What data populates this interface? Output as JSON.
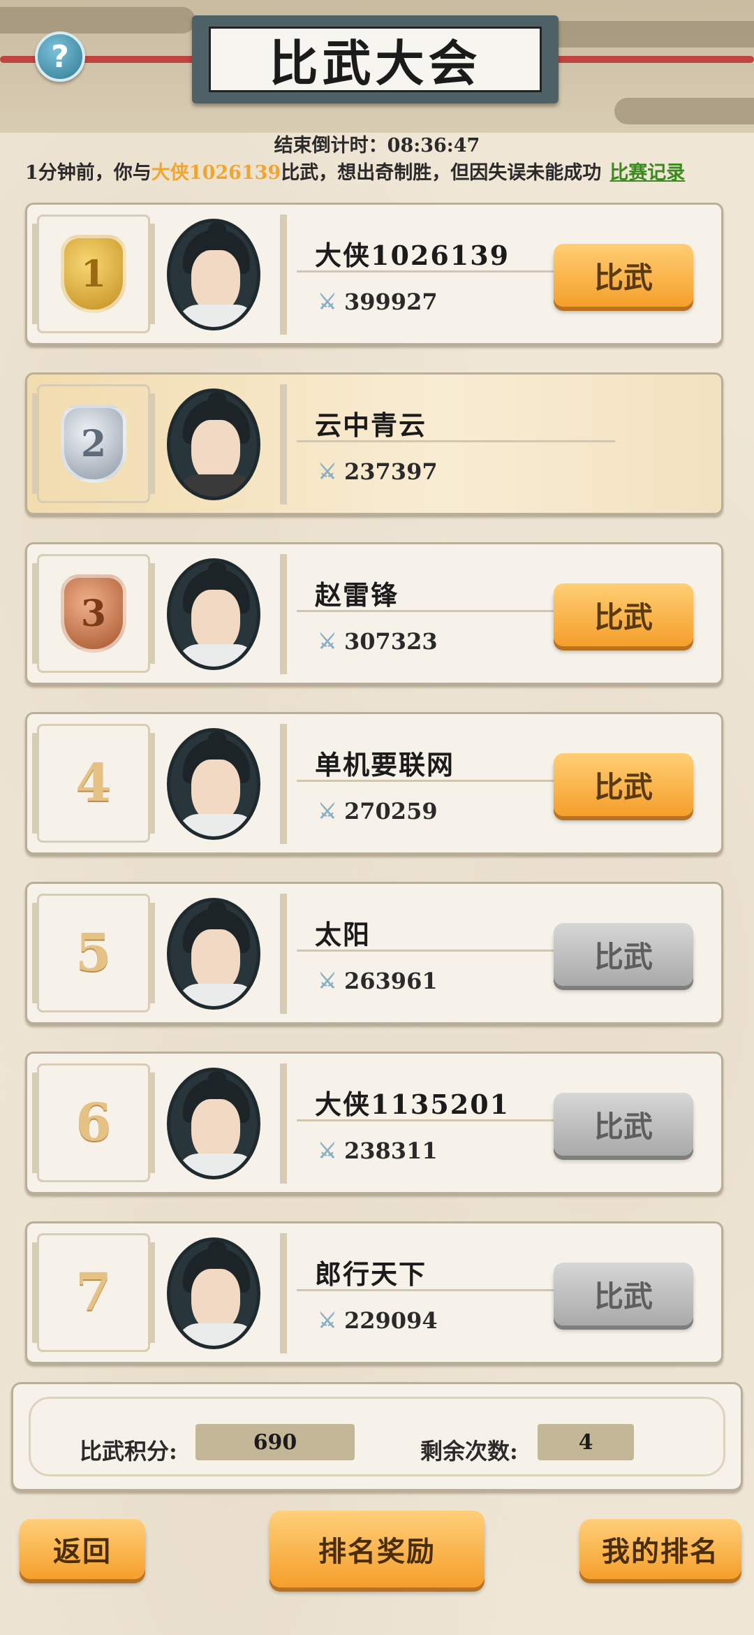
{
  "header": {
    "title": "比武大会",
    "help_icon": "question-mark-icon",
    "help_symbol": "?"
  },
  "countdown": {
    "label": "结束倒计时：",
    "time": "08:36:47"
  },
  "battle_log": {
    "prefix": "1分钟前，你与",
    "opponent": "大侠1026139",
    "suffix": "比武，想出奇制胜，但因失误未能成功",
    "record_link": "比赛记录",
    "highlight_color": "#f2a52e",
    "link_color": "#3a8a1e"
  },
  "ranking": [
    {
      "rank": "1",
      "medal": "gold",
      "name": "大侠1026139",
      "power": "399927",
      "button": "比武",
      "button_enabled": true
    },
    {
      "rank": "2",
      "medal": "silver",
      "name": "云中青云",
      "power": "237397",
      "button": null,
      "button_enabled": false
    },
    {
      "rank": "3",
      "medal": "bronze",
      "name": "赵雷锋",
      "power": "307323",
      "button": "比武",
      "button_enabled": true
    },
    {
      "rank": "4",
      "medal": null,
      "name": "单机要联网",
      "power": "270259",
      "button": "比武",
      "button_enabled": true
    },
    {
      "rank": "5",
      "medal": null,
      "name": "太阳",
      "power": "263961",
      "button": "比武",
      "button_enabled": false
    },
    {
      "rank": "6",
      "medal": null,
      "name": "大侠1135201",
      "power": "238311",
      "button": "比武",
      "button_enabled": false
    },
    {
      "rank": "7",
      "medal": null,
      "name": "郎行天下",
      "power": "229094",
      "button": "比武",
      "button_enabled": false
    }
  ],
  "stats": {
    "score_label": "比武积分:",
    "score_value": "690",
    "remaining_label": "剩余次数:",
    "remaining_value": "4"
  },
  "bottom_buttons": {
    "back": "返回",
    "rewards": "排名奖励",
    "my_rank": "我的排名"
  },
  "icons": {
    "power": "crossed-swords-icon"
  }
}
